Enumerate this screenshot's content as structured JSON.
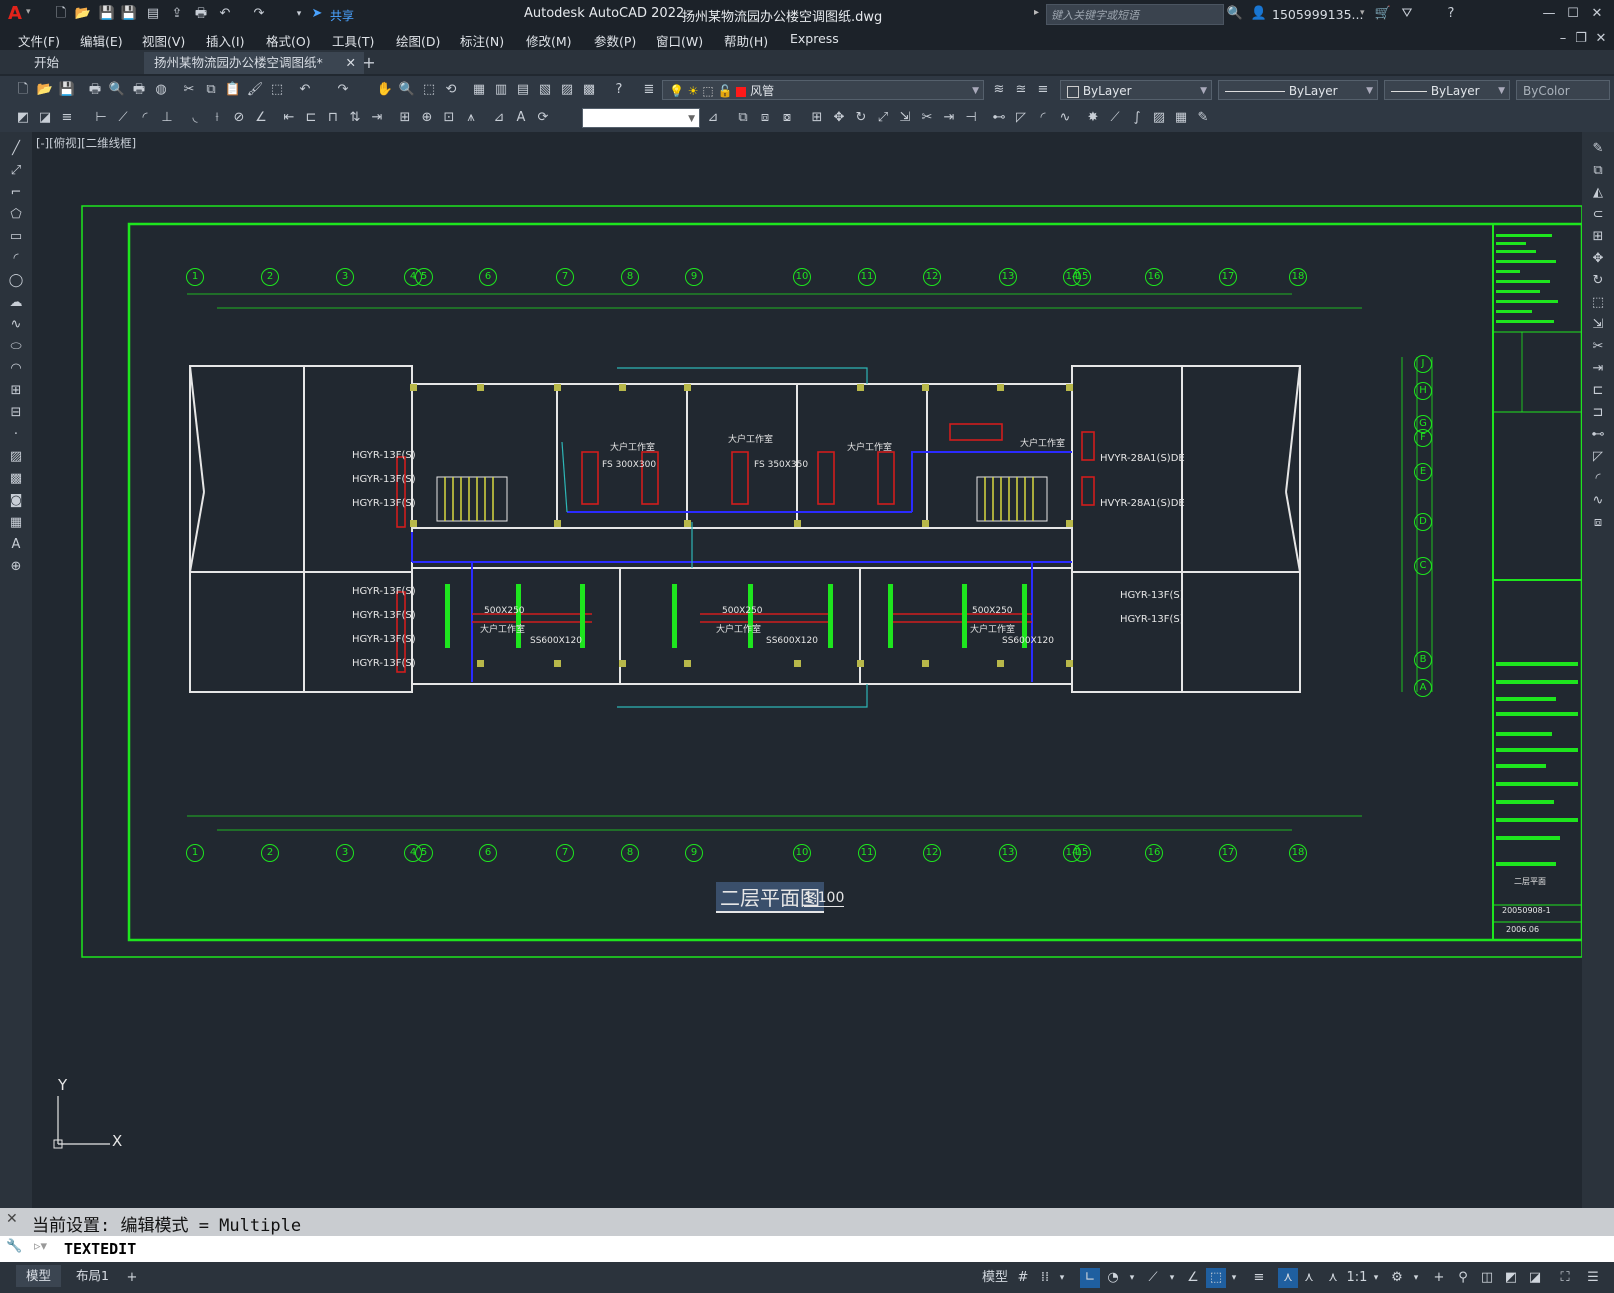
{
  "window": {
    "app_title": "Autodesk AutoCAD 2022",
    "file_title": "扬州某物流园办公楼空调图纸.dwg",
    "search_placeholder": "键入关键字或短语",
    "user": "1505999135...",
    "share_label": "共享"
  },
  "menus": [
    "文件(F)",
    "编辑(E)",
    "视图(V)",
    "插入(I)",
    "格式(O)",
    "工具(T)",
    "绘图(D)",
    "标注(N)",
    "修改(M)",
    "参数(P)",
    "窗口(W)",
    "帮助(H)",
    "Express"
  ],
  "tabs": {
    "start": "开始",
    "doc": "扬州某物流园办公楼空调图纸*"
  },
  "toolbar": {
    "layer": "风管",
    "layer_color": "#ff1a1a",
    "color_prop": "ByLayer",
    "linetype_prop": "ByLayer",
    "lineweight_prop": "ByLayer",
    "plotstyle_prop": "ByColor"
  },
  "viewport_label": "[-][俯视][二维线框]",
  "drawing": {
    "title": "二层平面图",
    "scale": "1:100",
    "grid_numbers": [
      "1",
      "2",
      "3",
      "4",
      "5",
      "6",
      "7",
      "8",
      "9",
      "10",
      "11",
      "12",
      "13",
      "14",
      "15",
      "16",
      "17",
      "18"
    ],
    "grid_letters": [
      "J",
      "H",
      "G",
      "F",
      "E",
      "D",
      "C",
      "B",
      "A"
    ],
    "room_label": "大户工作室",
    "left_units_top": [
      "HGYR-13F(S)",
      "HGYR-13F(S)",
      "HGYR-13F(S)"
    ],
    "left_units_bottom": [
      "HGYR-13F(S)",
      "HGYR-13F(S)",
      "HGYR-13F(S)",
      "HGYR-13F(S)"
    ],
    "right_units": [
      "HVYR-28A1(S)DE",
      "HVYR-28A1(S)DE"
    ],
    "right_units_bottom": [
      "HGYR-13F(S)",
      "HGYR-13F(S)"
    ],
    "duct_labels": [
      "500X250",
      "500X250",
      "500X250"
    ],
    "fs_labels": [
      "FS 300X300",
      "FS 350X350"
    ],
    "diffuser": "SS600X120",
    "title_block": {
      "drawing_no": "20050908-1",
      "date": "2006.06",
      "sheet_name": "二层平面"
    }
  },
  "axis": {
    "x": "X",
    "y": "Y"
  },
  "command": {
    "history": "当前设置: 编辑模式 = Multiple",
    "current": "TEXTEDIT"
  },
  "status": {
    "model_tab": "模型",
    "layout_tab": "布局1",
    "model_label": "模型",
    "scale": "1:1"
  },
  "colors": {
    "green": "#1ee51e",
    "white": "#e6e6e6",
    "red": "#d01d1d",
    "blue": "#2a2aff",
    "cyan": "#2db5b5",
    "yellow": "#b8b84a"
  }
}
